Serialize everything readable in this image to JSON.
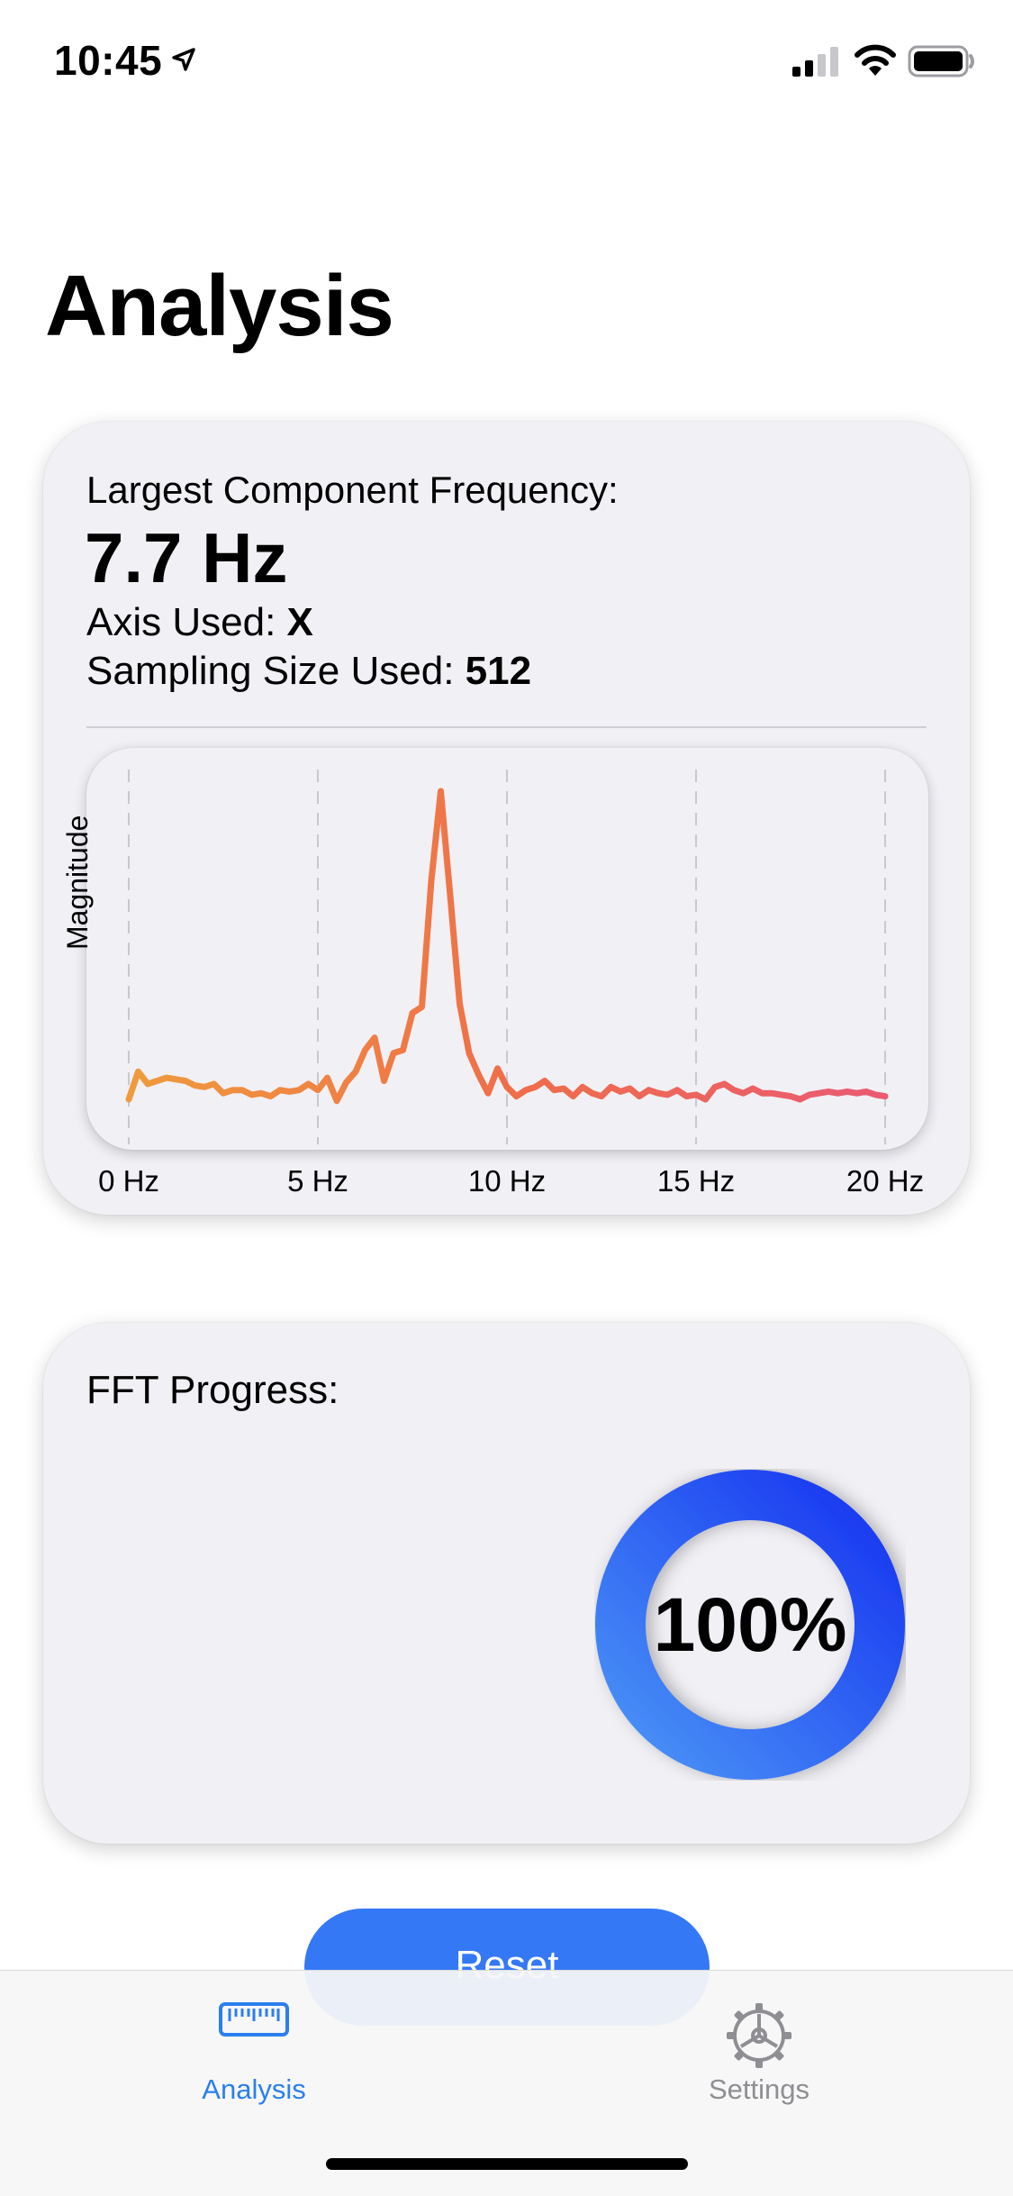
{
  "status_bar": {
    "time": "10:45"
  },
  "page": {
    "title": "Analysis"
  },
  "analysis_card": {
    "frequency_label": "Largest Component Frequency:",
    "frequency_value": "7.7 Hz",
    "axis_label": "Axis Used: ",
    "axis_value": "X",
    "sampling_label": "Sampling Size Used: ",
    "sampling_value": "512"
  },
  "chart_data": {
    "type": "line",
    "ylabel": "Magnitude",
    "xlim": [
      0,
      20
    ],
    "ylim": [
      0,
      1
    ],
    "x_ticks": [
      "0 Hz",
      "5 Hz",
      "10 Hz",
      "15 Hz",
      "20 Hz"
    ],
    "gradient_colors": [
      "#ef9b3c",
      "#ef6e4a",
      "#ea5a72"
    ],
    "x": [
      0,
      0.25,
      0.5,
      0.75,
      1,
      1.25,
      1.5,
      1.75,
      2,
      2.25,
      2.5,
      2.75,
      3,
      3.25,
      3.5,
      3.75,
      4,
      4.25,
      4.5,
      4.75,
      5,
      5.25,
      5.5,
      5.75,
      6,
      6.25,
      6.5,
      6.75,
      7,
      7.25,
      7.5,
      7.75,
      8,
      8.25,
      8.5,
      8.75,
      9,
      9.25,
      9.5,
      9.75,
      10,
      10.25,
      10.5,
      10.75,
      11,
      11.25,
      11.5,
      11.75,
      12,
      12.25,
      12.5,
      12.75,
      13,
      13.25,
      13.5,
      13.75,
      14,
      14.25,
      14.5,
      14.75,
      15,
      15.25,
      15.5,
      15.75,
      16,
      16.25,
      16.5,
      16.75,
      17,
      17.25,
      17.5,
      17.75,
      18,
      18.25,
      18.5,
      18.75,
      19,
      19.25,
      19.5,
      19.75,
      20
    ],
    "values": [
      0.0,
      0.09,
      0.05,
      0.06,
      0.07,
      0.065,
      0.06,
      0.045,
      0.04,
      0.05,
      0.02,
      0.03,
      0.03,
      0.015,
      0.02,
      0.01,
      0.03,
      0.025,
      0.03,
      0.05,
      0.03,
      0.07,
      -0.005,
      0.055,
      0.09,
      0.16,
      0.2,
      0.06,
      0.15,
      0.16,
      0.28,
      0.3,
      0.71,
      1.0,
      0.66,
      0.31,
      0.15,
      0.08,
      0.02,
      0.1,
      0.04,
      0.01,
      0.03,
      0.04,
      0.06,
      0.03,
      0.035,
      0.01,
      0.04,
      0.02,
      0.01,
      0.04,
      0.025,
      0.035,
      0.01,
      0.03,
      0.02,
      0.015,
      0.03,
      0.01,
      0.015,
      0.0,
      0.04,
      0.05,
      0.03,
      0.02,
      0.035,
      0.02,
      0.02,
      0.015,
      0.01,
      0.0,
      0.015,
      0.02,
      0.025,
      0.02,
      0.025,
      0.02,
      0.025,
      0.015,
      0.01
    ]
  },
  "progress_card": {
    "label": "FFT Progress:",
    "percent_text": "100%",
    "progress": 1.0
  },
  "reset_button": {
    "label": "Reset"
  },
  "tab_bar": {
    "items": [
      {
        "label": "Analysis",
        "icon": "ruler-icon",
        "selected": true,
        "color": "#2b7fed"
      },
      {
        "label": "Settings",
        "icon": "gear-icon",
        "selected": false,
        "color": "#8e8e93"
      }
    ]
  }
}
